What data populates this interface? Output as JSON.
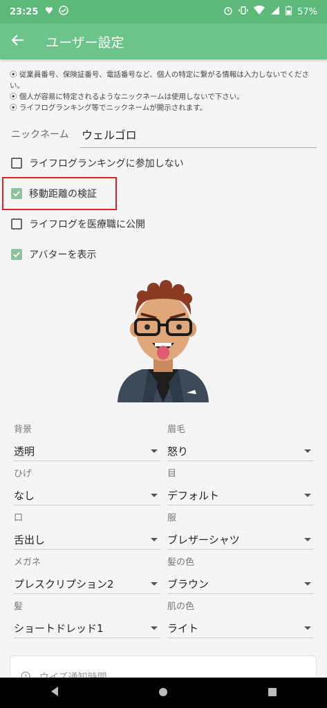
{
  "status": {
    "time": "23:25",
    "battery": "57%"
  },
  "appbar": {
    "title": "ユーザー設定"
  },
  "notes": [
    "⦿ 従業員番号、保険証番号、電話番号など、個人の特定に繋がる情報は入力しないでください。",
    "⦿ 個人が容易に特定されるようなニックネームは使用しないで下さい。",
    "⦿ ライフログランキング等でニックネームが開示されます。"
  ],
  "nickname": {
    "label": "ニックネーム",
    "value": "ウェルゴロ"
  },
  "checkboxes": [
    {
      "label": "ライフログランキングに参加しない",
      "checked": false
    },
    {
      "label": "移動距離の検証",
      "checked": true
    },
    {
      "label": "ライフログを医療職に公開",
      "checked": false
    },
    {
      "label": "アバターを表示",
      "checked": true
    }
  ],
  "selects": [
    {
      "label": "背景",
      "value": "透明"
    },
    {
      "label": "眉毛",
      "value": "怒り"
    },
    {
      "label": "ひげ",
      "value": "なし"
    },
    {
      "label": "目",
      "value": "デフォルト"
    },
    {
      "label": "口",
      "value": "舌出し"
    },
    {
      "label": "服",
      "value": "ブレザーシャツ"
    },
    {
      "label": "メガネ",
      "value": "プレスクリプション2"
    },
    {
      "label": "髪の色",
      "value": "ブラウン"
    },
    {
      "label": "髪",
      "value": "ショートドレッド1"
    },
    {
      "label": "肌の色",
      "value": "ライト"
    }
  ],
  "card": {
    "label": "ウイズ通知時間"
  },
  "colors": {
    "appbar": "#6cc48a",
    "statusbar": "#5cb97a",
    "checkbox": "#8cc29c",
    "highlight": "#e02020"
  }
}
